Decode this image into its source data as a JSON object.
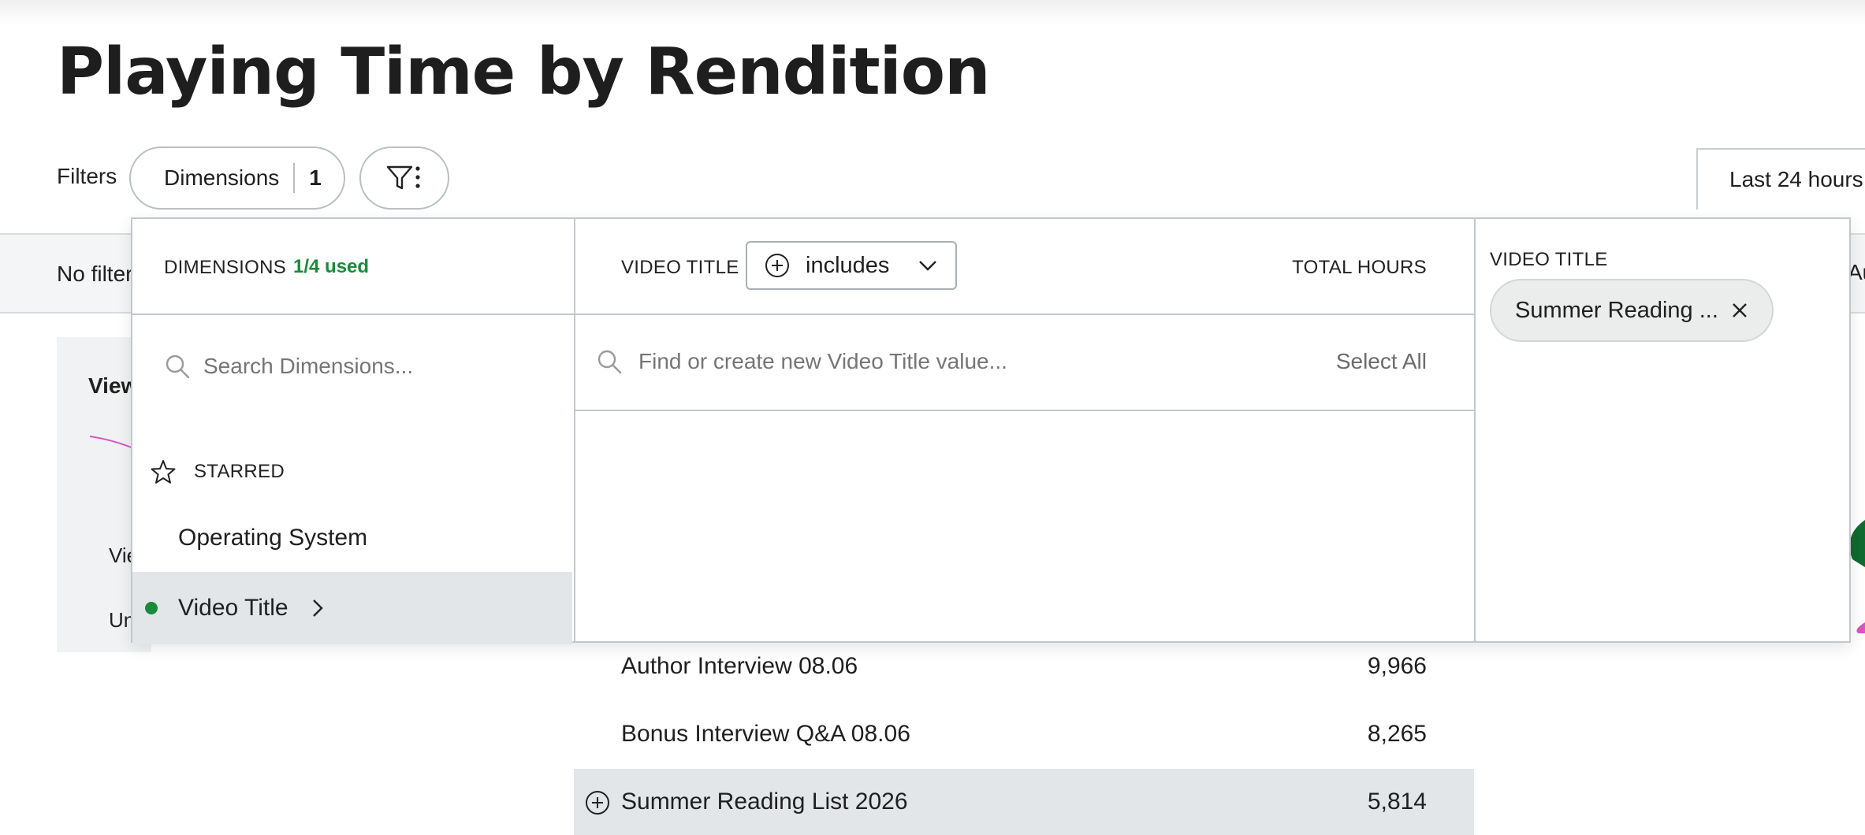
{
  "page": {
    "title": "Playing Time by Rendition"
  },
  "filters": {
    "label": "Filters",
    "dimensions_button": {
      "label": "Dimensions",
      "count": "1"
    },
    "filter_icon": "filter-more-icon",
    "date_range": "Last 24 hours"
  },
  "filter_bar": {
    "text": "No filter",
    "right_fragment": "Au"
  },
  "chart_card": {
    "title": "View",
    "tick1": "Vie",
    "tick2": "Un"
  },
  "dropdown": {
    "left": {
      "header": "DIMENSIONS",
      "used": "1/4 used",
      "search_placeholder": "Search Dimensions...",
      "starred_label": "STARRED",
      "items": [
        {
          "label": "Operating System",
          "selected": false
        },
        {
          "label": "Video Title",
          "selected": true
        }
      ]
    },
    "middle": {
      "header": "VIDEO TITLE",
      "operator": "includes",
      "total_header": "TOTAL HOURS",
      "find_placeholder": "Find or create new Video Title value...",
      "select_all": "Select All",
      "rows": [
        {
          "name": "Author Interview 08.06",
          "value": "9,966"
        },
        {
          "name": "Bonus Interview Q&A 08.06",
          "value": "8,265"
        },
        {
          "name": "Summer Reading List 2026",
          "value": "5,814"
        }
      ]
    },
    "right": {
      "header": "VIDEO TITLE",
      "chips": [
        {
          "label": "Summer Reading ..."
        }
      ]
    }
  },
  "colors": {
    "accent_green": "#1a8a3c",
    "highlight": "#e3e6e9",
    "border": "#c2c7cc"
  }
}
